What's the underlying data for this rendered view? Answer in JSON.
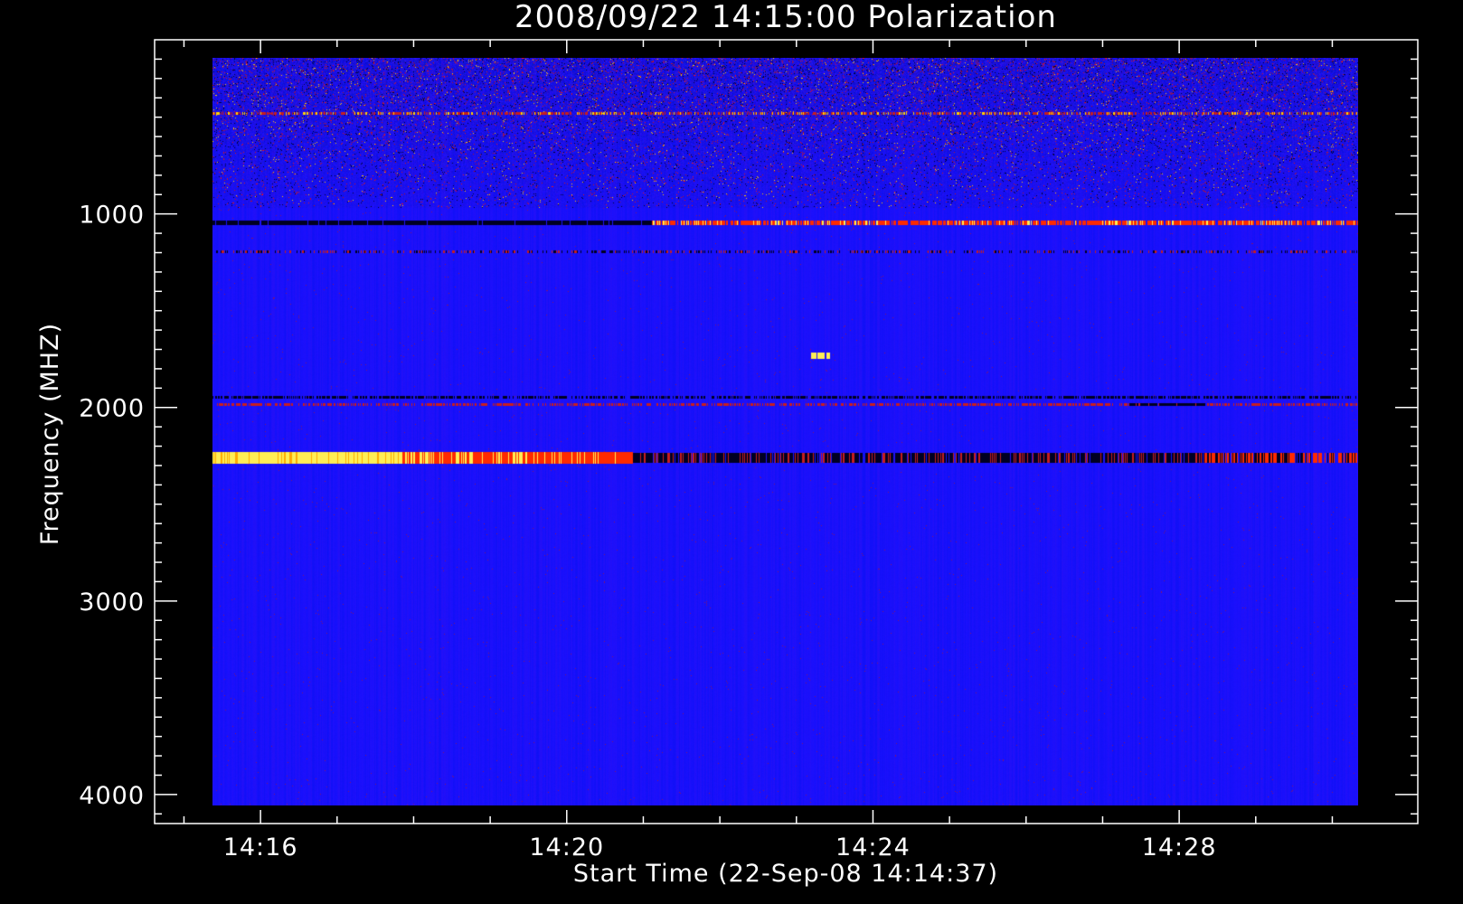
{
  "chart_data": {
    "type": "heatmap",
    "title": "2008/09/22 14:15:00 Polarization",
    "xlabel": "Start Time (22-Sep-08 14:14:37)",
    "ylabel": "Frequency (MHZ)",
    "y_inverted": true,
    "xlim": [
      "14:14:37",
      "14:31:07"
    ],
    "ylim": [
      100,
      4150
    ],
    "x_major_ticks": [
      {
        "value": "14:16",
        "label": "14:16"
      },
      {
        "value": "14:20",
        "label": "14:20"
      },
      {
        "value": "14:24",
        "label": "14:24"
      },
      {
        "value": "14:28",
        "label": "14:28"
      }
    ],
    "x_minor_ticks": [
      "14:15",
      "14:17",
      "14:18",
      "14:19",
      "14:21",
      "14:22",
      "14:23",
      "14:25",
      "14:26",
      "14:27",
      "14:29",
      "14:30"
    ],
    "y_major_ticks": [
      {
        "value": 1000,
        "label": "1000"
      },
      {
        "value": 2000,
        "label": "2000"
      },
      {
        "value": 3000,
        "label": "3000"
      },
      {
        "value": 4000,
        "label": "4000"
      }
    ],
    "y_minor_tick_step": 100,
    "data_extent": {
      "time_start": "14:15:00",
      "time_end": "14:30:00",
      "freq_min": 100,
      "freq_max": 4000
    },
    "colors": {
      "background": "#000000",
      "axes": "#ffffff",
      "base": "#1a10ff",
      "noise_dark": "#000033",
      "noise_red": "#c81e1e",
      "noise_bright": "#ffd200",
      "band_bright": "#ffee55",
      "band_red": "#ff2a00",
      "band_dark": "#000022"
    },
    "features": [
      {
        "description": "noisy low-frequency region",
        "freq_range": [
          100,
          880
        ]
      },
      {
        "description": "bright speckle line",
        "freq": 390,
        "time_range": [
          "14:15:00",
          "14:30:00"
        ]
      },
      {
        "description": "dark line",
        "freq": 960,
        "time_range": [
          "14:15:00",
          "14:20:45"
        ]
      },
      {
        "description": "red line",
        "freq": 960,
        "time_range": [
          "14:20:45",
          "14:30:00"
        ]
      },
      {
        "description": "red dashed line",
        "freq": 1110,
        "time_range": [
          "14:15:00",
          "14:30:00"
        ]
      },
      {
        "description": "dark line",
        "freq": 1870,
        "time_range": [
          "14:15:00",
          "14:30:00"
        ]
      },
      {
        "description": "red line",
        "freq": 1905,
        "time_range": [
          "14:15:00",
          "14:30:00"
        ]
      },
      {
        "description": "dark segment",
        "freq": 1905,
        "time_range": [
          "14:27:00",
          "14:28:00"
        ]
      },
      {
        "description": "bright yellow band fading to red",
        "freq": 2185,
        "time_range": [
          "14:15:00",
          "14:20:30"
        ]
      },
      {
        "description": "dark band",
        "freq": 2185,
        "time_range": [
          "14:20:30",
          "14:28:00"
        ]
      },
      {
        "description": "red band",
        "freq": 2185,
        "time_range": [
          "14:28:00",
          "14:30:00"
        ]
      },
      {
        "description": "small bright spot",
        "freq": 1650,
        "time_range": [
          "14:22:50",
          "14:23:05"
        ]
      }
    ]
  }
}
